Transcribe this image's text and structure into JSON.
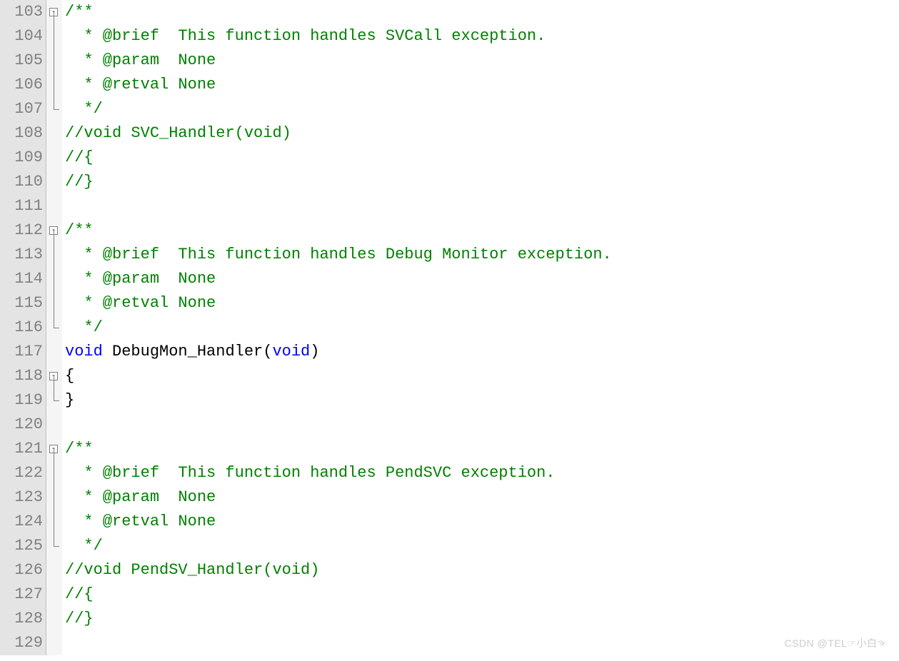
{
  "watermark": "CSDN @TEL☞小白☜",
  "lines": [
    {
      "num": "103",
      "fold": "open",
      "tokens": [
        {
          "cls": "c-comment",
          "t": "/**"
        }
      ]
    },
    {
      "num": "104",
      "fold": "mid",
      "tokens": [
        {
          "cls": "c-comment",
          "t": "  * @brief  This function handles SVCall exception."
        }
      ]
    },
    {
      "num": "105",
      "fold": "mid",
      "tokens": [
        {
          "cls": "c-comment",
          "t": "  * @param  None"
        }
      ]
    },
    {
      "num": "106",
      "fold": "mid",
      "tokens": [
        {
          "cls": "c-comment",
          "t": "  * @retval None"
        }
      ]
    },
    {
      "num": "107",
      "fold": "end",
      "tokens": [
        {
          "cls": "c-comment",
          "t": "  */"
        }
      ]
    },
    {
      "num": "108",
      "fold": "none",
      "tokens": [
        {
          "cls": "c-comment",
          "t": "//void SVC_Handler(void)"
        }
      ]
    },
    {
      "num": "109",
      "fold": "none",
      "tokens": [
        {
          "cls": "c-comment",
          "t": "//{"
        }
      ]
    },
    {
      "num": "110",
      "fold": "none",
      "tokens": [
        {
          "cls": "c-comment",
          "t": "//}"
        }
      ]
    },
    {
      "num": "111",
      "fold": "none",
      "tokens": [
        {
          "cls": "c-text",
          "t": ""
        }
      ]
    },
    {
      "num": "112",
      "fold": "open",
      "tokens": [
        {
          "cls": "c-comment",
          "t": "/**"
        }
      ]
    },
    {
      "num": "113",
      "fold": "mid",
      "tokens": [
        {
          "cls": "c-comment",
          "t": "  * @brief  This function handles Debug Monitor exception."
        }
      ]
    },
    {
      "num": "114",
      "fold": "mid",
      "tokens": [
        {
          "cls": "c-comment",
          "t": "  * @param  None"
        }
      ]
    },
    {
      "num": "115",
      "fold": "mid",
      "tokens": [
        {
          "cls": "c-comment",
          "t": "  * @retval None"
        }
      ]
    },
    {
      "num": "116",
      "fold": "end",
      "tokens": [
        {
          "cls": "c-comment",
          "t": "  */"
        }
      ]
    },
    {
      "num": "117",
      "fold": "none",
      "tokens": [
        {
          "cls": "c-keyword",
          "t": "void"
        },
        {
          "cls": "c-text",
          "t": " DebugMon_Handler("
        },
        {
          "cls": "c-keyword",
          "t": "void"
        },
        {
          "cls": "c-text",
          "t": ")"
        }
      ]
    },
    {
      "num": "118",
      "fold": "open",
      "tokens": [
        {
          "cls": "c-text",
          "t": "{"
        }
      ]
    },
    {
      "num": "119",
      "fold": "end",
      "tokens": [
        {
          "cls": "c-text",
          "t": "}"
        }
      ]
    },
    {
      "num": "120",
      "fold": "none",
      "tokens": [
        {
          "cls": "c-text",
          "t": ""
        }
      ]
    },
    {
      "num": "121",
      "fold": "open",
      "tokens": [
        {
          "cls": "c-comment",
          "t": "/**"
        }
      ]
    },
    {
      "num": "122",
      "fold": "mid",
      "tokens": [
        {
          "cls": "c-comment",
          "t": "  * @brief  This function handles PendSVC exception."
        }
      ]
    },
    {
      "num": "123",
      "fold": "mid",
      "tokens": [
        {
          "cls": "c-comment",
          "t": "  * @param  None"
        }
      ]
    },
    {
      "num": "124",
      "fold": "mid",
      "tokens": [
        {
          "cls": "c-comment",
          "t": "  * @retval None"
        }
      ]
    },
    {
      "num": "125",
      "fold": "end",
      "tokens": [
        {
          "cls": "c-comment",
          "t": "  */"
        }
      ]
    },
    {
      "num": "126",
      "fold": "none",
      "tokens": [
        {
          "cls": "c-comment",
          "t": "//void PendSV_Handler(void)"
        }
      ]
    },
    {
      "num": "127",
      "fold": "none",
      "tokens": [
        {
          "cls": "c-comment",
          "t": "//{"
        }
      ]
    },
    {
      "num": "128",
      "fold": "none",
      "tokens": [
        {
          "cls": "c-comment",
          "t": "//}"
        }
      ]
    },
    {
      "num": "129",
      "fold": "none",
      "tokens": [
        {
          "cls": "c-text",
          "t": ""
        }
      ]
    }
  ]
}
